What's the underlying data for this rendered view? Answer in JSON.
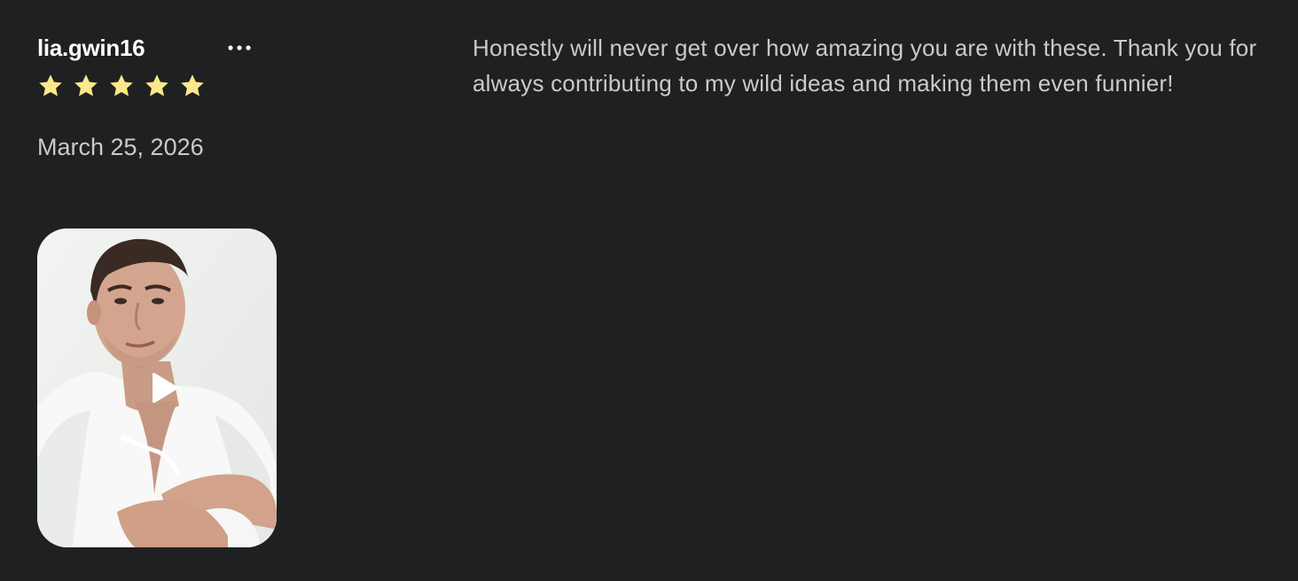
{
  "review": {
    "username": "lia.gwin16",
    "rating": 5,
    "rating_max": 5,
    "date": "March 25, 2026",
    "text": "Honestly will never get over how amazing you are with these. Thank you for always contributing to my wild ideas and making them even funnier!",
    "more_icon": "more-horizontal-icon",
    "star_icon": "star-icon",
    "play_icon": "play-icon"
  },
  "colors": {
    "background": "#1f2022",
    "username": "#ffffff",
    "secondary_text": "#c9cacc",
    "star": "#fbe88a"
  }
}
